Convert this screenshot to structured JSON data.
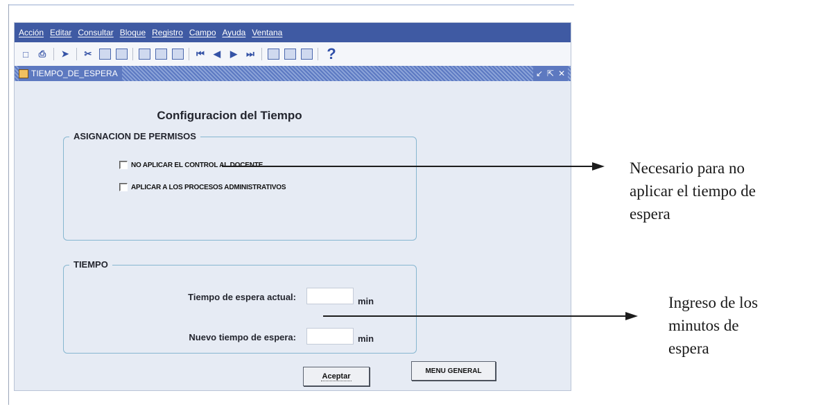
{
  "menubar": {
    "items": [
      "Acción",
      "Editar",
      "Consultar",
      "Bloque",
      "Registro",
      "Campo",
      "Ayuda",
      "Ventana"
    ]
  },
  "toolbar": {
    "icons": [
      "save-icon",
      "print-icon",
      "exit-icon",
      "cut-icon",
      "copy-icon",
      "paste-icon",
      "enter-query-icon",
      "execute-query-icon",
      "count-query-icon",
      "first-record-icon",
      "previous-record-icon",
      "next-record-icon",
      "last-record-icon",
      "insert-record-icon",
      "delete-record-icon",
      "lock-record-icon",
      "help-icon"
    ],
    "help_glyph": "?"
  },
  "window": {
    "title": "TIEMPO_DE_ESPERA",
    "controls": [
      "↙",
      "⇱",
      "✕"
    ]
  },
  "form": {
    "title": "Configuracion del Tiempo",
    "permisos": {
      "legend": "ASIGNACION DE PERMISOS",
      "option1": "NO APLICAR EL CONTROL AL DOCENTE",
      "option2": "APLICAR A LOS PROCESOS ADMINISTRATIVOS"
    },
    "tiempo": {
      "legend": "TIEMPO",
      "actual_label": "Tiempo de espera actual:",
      "actual_value": "",
      "nuevo_label": "Nuevo tiempo de espera:",
      "nuevo_value": "",
      "unit": "min"
    },
    "aceptar_label": "Aceptar",
    "menu_general_label": "MENU GENERAL"
  },
  "annotations": {
    "note1": [
      "Necesario para no",
      "aplicar el tiempo de",
      "espera"
    ],
    "note2": [
      "Ingreso de los",
      "minutos de",
      "espera"
    ]
  },
  "colors": {
    "menubar": "#3f5aa3",
    "titlebar": "#5d79c0",
    "form_bg": "#e6ebf4",
    "group_border": "#86b6d0"
  }
}
